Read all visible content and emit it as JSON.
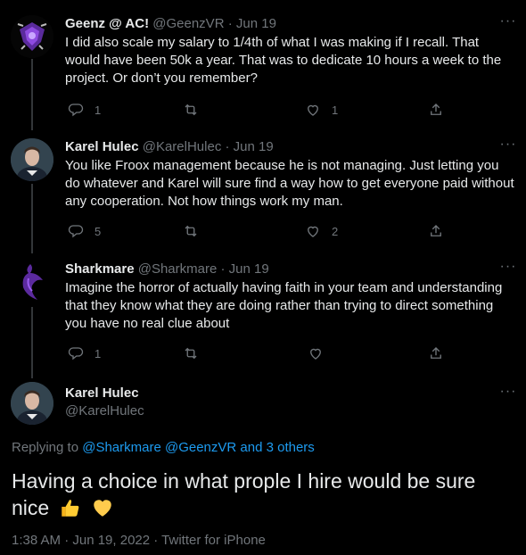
{
  "tweets": [
    {
      "name": "Geenz @ AC!",
      "handle": "@GeenzVR",
      "date": "Jun 19",
      "text": "I did also scale my salary to 1/4th of what I was making if I recall.  That would have been 50k a year.  That was to dedicate 10 hours a week to the project.  Or don’t you remember?",
      "reply_count": "1",
      "retweet_count": "",
      "like_count": "1",
      "avatar_icon": "purple-logo-avatar"
    },
    {
      "name": "Karel Hulec",
      "handle": "@KarelHulec",
      "date": "Jun 19",
      "text": "You like Froox management because he is not managing. Just letting you do whatever and Karel will sure find a way how to get everyone paid without any cooperation. Not how things work my man.",
      "reply_count": "5",
      "retweet_count": "",
      "like_count": "2",
      "avatar_icon": "man-portrait-avatar"
    },
    {
      "name": "Sharkmare",
      "handle": "@Sharkmare",
      "date": "Jun 19",
      "text": "Imagine the horror of actually having faith in your team and understanding that they know what they are doing rather than trying to direct something you have no real clue about",
      "reply_count": "1",
      "retweet_count": "",
      "like_count": "",
      "avatar_icon": "purple-shark-avatar"
    }
  ],
  "focus": {
    "name": "Karel Hulec",
    "handle": "@KarelHulec",
    "replying_prefix": "Replying to",
    "replying_links": "@Sharkmare @GeenzVR and 3 others",
    "text": "Having a choice in what prople I hire would be sure nice",
    "emojis": [
      "thumbs-up-emoji",
      "yellow-heart-emoji"
    ],
    "timestamp": "1:38 AM · Jun 19, 2022 · Twitter for iPhone"
  },
  "separator": "·",
  "colors": {
    "background": "#000000",
    "text": "#e7e9ea",
    "muted": "#71767b",
    "link": "#1d9bf0",
    "thread_line": "#333639"
  }
}
